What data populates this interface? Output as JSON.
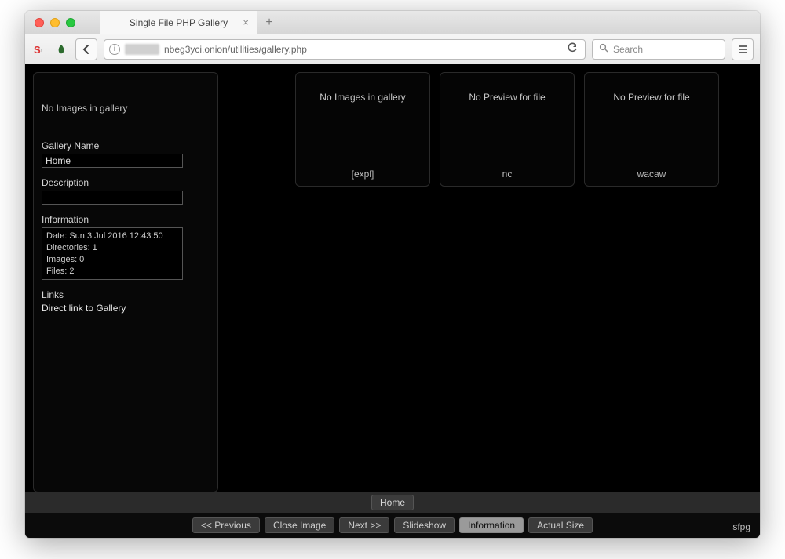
{
  "browser": {
    "tab_title": "Single File PHP Gallery",
    "url_visible_suffix": "nbeg3yci.onion/utilities/gallery.php",
    "search_placeholder": "Search"
  },
  "sidebar": {
    "top_message": "No Images in gallery",
    "gallery_name_label": "Gallery Name",
    "gallery_name_value": "Home",
    "description_label": "Description",
    "description_value": "",
    "information_label": "Information",
    "info_date": "Date: Sun 3 Jul 2016 12:43:50",
    "info_dirs": "Directories: 1",
    "info_images": "Images: 0",
    "info_files": "Files: 2",
    "links_label": "Links",
    "links_value": "Direct link to Gallery"
  },
  "thumbs": [
    {
      "message": "No Images in gallery",
      "caption": "[expl]"
    },
    {
      "message": "No Preview for file",
      "caption": "nc"
    },
    {
      "message": "No Preview for file",
      "caption": "wacaw"
    }
  ],
  "breadcrumb": {
    "home": "Home"
  },
  "bottom_buttons": {
    "prev": "<< Previous",
    "close": "Close Image",
    "next": "Next >>",
    "slideshow": "Slideshow",
    "information": "Information",
    "actual": "Actual Size"
  },
  "brand": "sfpg"
}
